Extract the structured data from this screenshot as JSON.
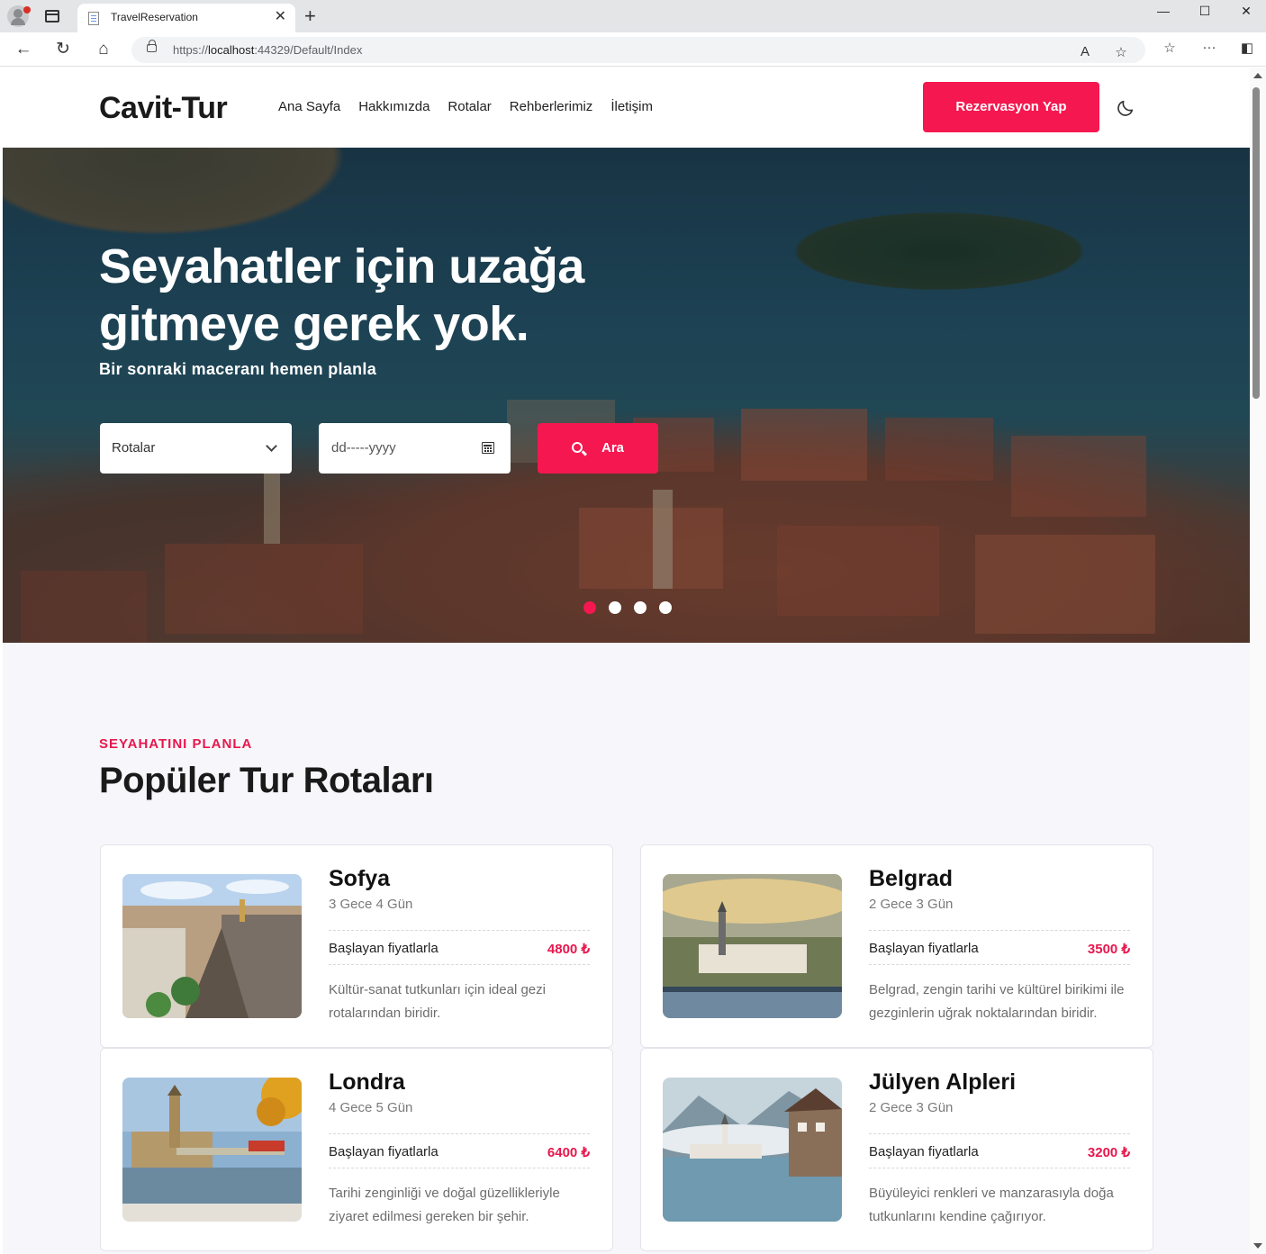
{
  "browser": {
    "tab_title": "TravelReservation",
    "tab_close": "✕",
    "new_tab": "+",
    "url_prefix": "https://",
    "url_host": "localhost",
    "url_rest": ":44329/Default/Index",
    "window_controls": {
      "minimize": "—",
      "maximize": "☐",
      "close": "✕"
    },
    "nav_icons": {
      "back": "←",
      "refresh": "↻",
      "home": "⌂"
    },
    "addr_icons": {
      "read_aloud": "A",
      "favorite": "☆",
      "favorites": "☆",
      "more": "···",
      "sidebar": "◧"
    }
  },
  "header": {
    "logo": "Cavit-Tur",
    "nav": [
      "Ana Sayfa",
      "Hakkımızda",
      "Rotalar",
      "Rehberlerimiz",
      "İletişim"
    ],
    "reserve_button": "Rezervasyon Yap"
  },
  "hero": {
    "title": "Seyahatler için uzağa gitmeye gerek yok.",
    "subtitle": "Bir sonraki maceranı hemen planla",
    "route_select": "Rotalar",
    "date_placeholder": "dd-----yyyy",
    "search_button": "Ara",
    "slides": 4,
    "active_slide": 1
  },
  "section": {
    "kicker": "SEYAHATINI PLANLA",
    "title": "Popüler Tur Rotaları"
  },
  "tours": [
    {
      "name": "Sofya",
      "duration": "3 Gece 4 Gün",
      "price_label": "Başlayan fiyatlarla",
      "price": "4800 ₺",
      "description": "Kültür-sanat tutkunları için ideal gezi rotalarından biridir."
    },
    {
      "name": "Belgrad",
      "duration": "2 Gece 3 Gün",
      "price_label": "Başlayan fiyatlarla",
      "price": "3500 ₺",
      "description": "Belgrad, zengin tarihi ve kültürel birikimi ile gezginlerin uğrak noktalarından biridir."
    },
    {
      "name": "Londra",
      "duration": "4 Gece 5 Gün",
      "price_label": "Başlayan fiyatlarla",
      "price": "6400 ₺",
      "description": "Tarihi zenginliği ve doğal güzellikleriyle ziyaret edilmesi gereken bir şehir."
    },
    {
      "name": "Jülyen Alpleri",
      "duration": "2 Gece 3 Gün",
      "price_label": "Başlayan fiyatlarla",
      "price": "3200 ₺",
      "description": "Büyüleyici renkleri ve manzarasıyla doğa tutkunlarını kendine çağırıyor."
    }
  ],
  "colors": {
    "accent": "#f5174f",
    "price": "#e8174d",
    "page_bg": "#f7f7fb"
  }
}
